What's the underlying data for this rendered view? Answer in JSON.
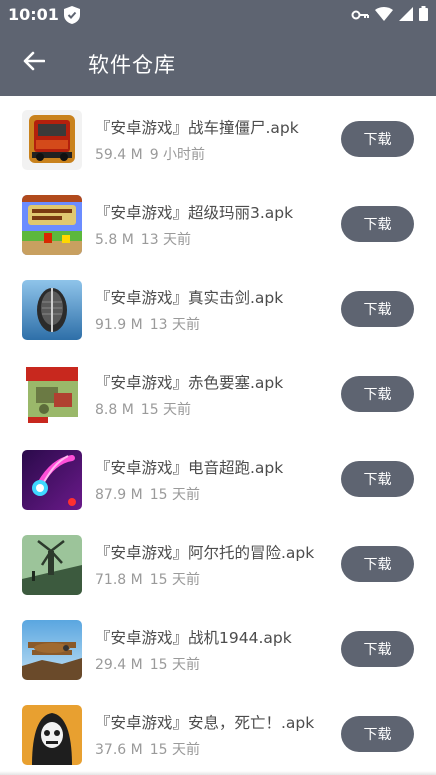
{
  "status_bar": {
    "time": "10:01"
  },
  "header": {
    "title": "软件仓库"
  },
  "items": [
    {
      "name": "『安卓游戏』战车撞僵尸.apk",
      "size": "59.4 M",
      "age": "9 小时前",
      "button_label": "下载",
      "icon": "zombie-truck-game-icon"
    },
    {
      "name": "『安卓游戏』超级玛丽3.apk",
      "size": "5.8 M",
      "age": "13 天前",
      "button_label": "下载",
      "icon": "super-mario-game-icon"
    },
    {
      "name": "『安卓游戏』真实击剑.apk",
      "size": "91.9 M",
      "age": "13 天前",
      "button_label": "下载",
      "icon": "fencing-game-icon"
    },
    {
      "name": "『安卓游戏』赤色要塞.apk",
      "size": "8.8 M",
      "age": "15 天前",
      "button_label": "下载",
      "icon": "red-fortress-game-icon"
    },
    {
      "name": "『安卓游戏』电音超跑.apk",
      "size": "87.9 M",
      "age": "15 天前",
      "button_label": "下载",
      "icon": "electro-racer-game-icon"
    },
    {
      "name": "『安卓游戏』阿尔托的冒险.apk",
      "size": "71.8 M",
      "age": "15 天前",
      "button_label": "下载",
      "icon": "alto-adventure-game-icon"
    },
    {
      "name": "『安卓游戏』战机1944.apk",
      "size": "29.4 M",
      "age": "15 天前",
      "button_label": "下载",
      "icon": "warplane-1944-game-icon"
    },
    {
      "name": "『安卓游戏』安息，死亡！.apk",
      "size": "37.6 M",
      "age": "15 天前",
      "button_label": "下载",
      "icon": "reaper-game-icon"
    }
  ]
}
